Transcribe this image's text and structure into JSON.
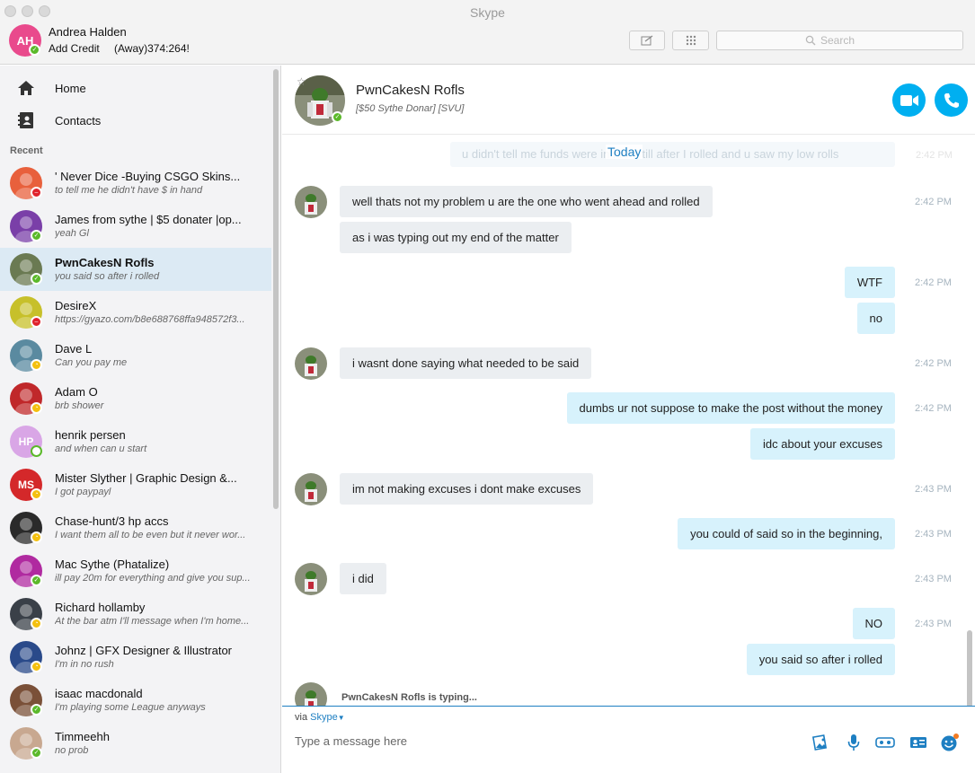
{
  "window": {
    "title": "Skype"
  },
  "me": {
    "initials": "AH",
    "name": "Andrea Halden",
    "credit_label": "Add Credit",
    "mood": "(Away)374:264!",
    "avatar_color": "#e94a8c"
  },
  "toolbar": {
    "compose_icon": "compose-icon",
    "dialpad_icon": "dialpad-icon",
    "search_placeholder": "Search"
  },
  "nav": {
    "home": "Home",
    "contacts": "Contacts",
    "recent": "Recent"
  },
  "contacts": [
    {
      "name": "' Never Dice -Buying CSGO Skins...",
      "message": "to tell me he didn't have $ in hand",
      "status": "dnd",
      "avatar": "#e8603c",
      "active": false
    },
    {
      "name": "James from sythe | $5 donater |op...",
      "message": "yeah Gl",
      "status": "online",
      "avatar": "#7a3fa8",
      "active": false
    },
    {
      "name": "PwnCakesN Rofls",
      "message": "you said so after i rolled",
      "status": "online",
      "avatar": "#6a7a52",
      "active": true
    },
    {
      "name": "DesireX",
      "message": "https://gyazo.com/b8e688768ffa948572f3...",
      "status": "dnd",
      "avatar": "#c7c02a",
      "active": false
    },
    {
      "name": "Dave L",
      "message": "Can you pay me",
      "status": "away",
      "avatar": "#5a8aa0",
      "active": false
    },
    {
      "name": "Adam O",
      "message": "brb shower",
      "status": "away",
      "avatar": "#c0282a",
      "active": false
    },
    {
      "name": "henrik persen",
      "message": "and when can u start",
      "status": "offline",
      "avatar": "#d9a6e6",
      "initials": "HP",
      "active": false
    },
    {
      "name": "Mister Slyther | Graphic Design &...",
      "message": "I got paypayl",
      "status": "away",
      "avatar": "#d4282a",
      "initials": "MS",
      "active": false
    },
    {
      "name": "Chase-hunt/3 hp accs",
      "message": "I want them all to be even but it never wor...",
      "status": "away",
      "avatar": "#2a2a2a",
      "active": false
    },
    {
      "name": "Mac Sythe (Phatalize)",
      "message": "ill pay 20m for everything and give you sup...",
      "status": "online",
      "avatar": "#b02aa0",
      "active": false
    },
    {
      "name": "Richard hollamby",
      "message": "At the bar atm I'll message when I'm home...",
      "status": "away",
      "avatar": "#3a4048",
      "active": false
    },
    {
      "name": "Johnz | GFX Designer & Illustrator",
      "message": "I'm in no rush",
      "status": "away",
      "avatar": "#2a4a8a",
      "active": false
    },
    {
      "name": "isaac macdonald",
      "message": "I'm playing some League anyways",
      "status": "online",
      "avatar": "#7a5038",
      "active": false
    },
    {
      "name": "Timmeehh",
      "message": "no prob",
      "status": "online",
      "avatar": "#c8a890",
      "active": false
    }
  ],
  "chat": {
    "name": "PwnCakesN Rofls",
    "mood": "[$50 Sythe Donar] [SVU]",
    "video_call_icon": "video-camera-icon",
    "audio_call_icon": "phone-icon",
    "day_separator": "Today",
    "faded_message": "u didn't tell me funds were in hand till after I rolled and u saw my low rolls",
    "faded_time": "2:42 PM",
    "messages": [
      {
        "text": "well thats not my problem u are the one who went ahead and rolled",
        "dir": "in",
        "time": "2:42 PM"
      },
      {
        "text": "as i was typing out my end of the matter",
        "dir": "in",
        "time": ""
      },
      {
        "text": "WTF",
        "dir": "out",
        "time": "2:42 PM"
      },
      {
        "text": "no",
        "dir": "out",
        "time": ""
      },
      {
        "text": "i wasnt done saying what needed to be said",
        "dir": "in",
        "time": "2:42 PM"
      },
      {
        "text": "dumbs ur not suppose to make the post without the money",
        "dir": "out",
        "time": "2:42 PM"
      },
      {
        "text": "idc about your excuses",
        "dir": "out",
        "time": ""
      },
      {
        "text": "im not making excuses i dont make excuses",
        "dir": "in",
        "time": "2:43 PM"
      },
      {
        "text": "you could of said so in the beginning,",
        "dir": "out",
        "time": "2:43 PM"
      },
      {
        "text": "i did",
        "dir": "in",
        "time": "2:43 PM"
      },
      {
        "text": "NO",
        "dir": "out",
        "time": "2:43 PM"
      },
      {
        "text": "you said so after i rolled",
        "dir": "out",
        "time": ""
      }
    ],
    "typing_indicator": "PwnCakesN Rofls is typing..."
  },
  "composer": {
    "via_prefix": "via",
    "via_link": "Skype",
    "placeholder": "Type a message here"
  },
  "colors": {
    "accent": "#00aff0",
    "link": "#1e7fc2",
    "online": "#5bb92a",
    "away": "#f4c00f",
    "dnd": "#e0232c"
  }
}
